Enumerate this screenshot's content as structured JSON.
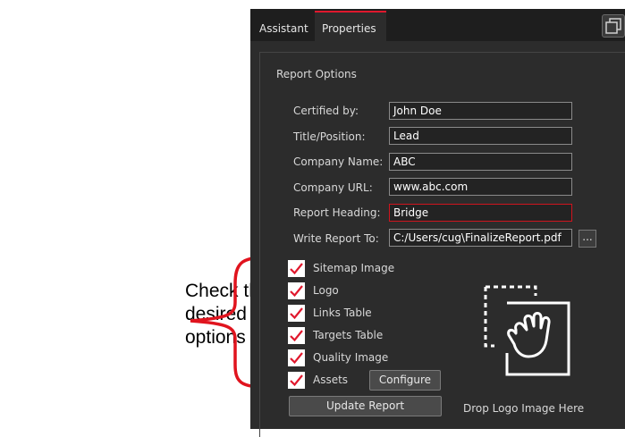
{
  "annotation": {
    "lines": [
      "Check the",
      "desired",
      "options here."
    ]
  },
  "tabs": [
    {
      "label": "Assistant",
      "active": false
    },
    {
      "label": "Properties",
      "active": true
    }
  ],
  "accent_color": "#e0182d",
  "section_title": "Report Options",
  "fields": [
    {
      "label": "Certified by:",
      "value": "John Doe",
      "error": false
    },
    {
      "label": "Title/Position:",
      "value": "Lead",
      "error": false
    },
    {
      "label": "Company Name:",
      "value": "ABC",
      "error": false
    },
    {
      "label": "Company URL:",
      "value": "www.abc.com",
      "error": false
    },
    {
      "label": "Report Heading:",
      "value": "Bridge",
      "error": true
    },
    {
      "label": "Write Report To:",
      "value": "C:/Users/cug\\FinalizeReport.pdf",
      "error": false
    }
  ],
  "browse_label": "...",
  "options": [
    {
      "label": "Sitemap Image",
      "checked": true
    },
    {
      "label": "Logo",
      "checked": true
    },
    {
      "label": "Links Table",
      "checked": true
    },
    {
      "label": "Targets Table",
      "checked": true
    },
    {
      "label": "Quality Image",
      "checked": true
    },
    {
      "label": "Assets",
      "checked": true
    }
  ],
  "configure_label": "Configure",
  "update_label": "Update Report",
  "drop_label": "Drop Logo Image Here",
  "icons": {
    "logo_drop": "hand-drag-icon",
    "window": "window-icon",
    "check": "checkmark-icon"
  }
}
